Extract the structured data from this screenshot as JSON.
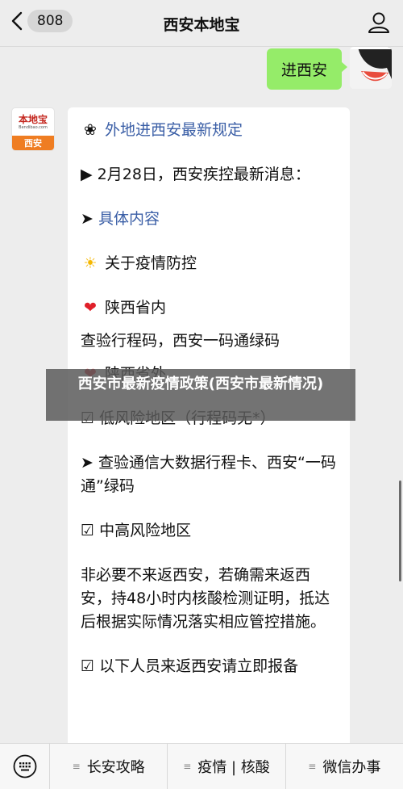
{
  "header": {
    "back_count": "808",
    "title": "西安本地宝"
  },
  "chat": {
    "outgoing_text": "进西安",
    "bot_avatar": {
      "logo": "本地宝",
      "sub": "Bendibao.com",
      "city": "西安"
    },
    "card": {
      "heading": "外地进西安最新规定",
      "date_line": "2月28日，西安疾控最新消息：",
      "details_link": "具体内容",
      "section1": "关于疫情防控",
      "in_province": "陕西省内",
      "in_province_note": "查验行程码，西安一码通绿码",
      "out_province": "陕西省外",
      "low_risk": "低风险地区（行程码无*）",
      "low_risk_rule": "查验通信大数据行程卡、西安“一码通”绿码",
      "mid_high_risk": "中高风险地区",
      "mid_high_rule": "非必要不来返西安，若确需来返西安，持48小时内核酸检测证明，抵达后根据实际情况落实相应管控措施。",
      "report": "以下人员来返西安请立即报备"
    }
  },
  "overlay": {
    "text": "西安市最新疫情政策(西安市最新情况)"
  },
  "bottom_menu": [
    "长安攻略",
    "疫情 | 核酸",
    "微信办事"
  ]
}
